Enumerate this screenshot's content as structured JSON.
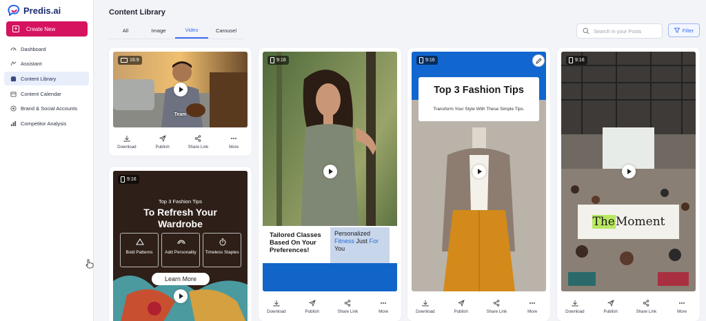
{
  "app": {
    "name": "Predis.ai"
  },
  "sidebar": {
    "create_label": "Create New",
    "items": [
      {
        "label": "Dashboard",
        "icon": "dashboard-icon"
      },
      {
        "label": "Assistant",
        "icon": "assistant-icon"
      },
      {
        "label": "Content Library",
        "icon": "library-icon",
        "active": true
      },
      {
        "label": "Content Calendar",
        "icon": "calendar-icon"
      },
      {
        "label": "Brand & Social Accounts",
        "icon": "brand-icon"
      },
      {
        "label": "Competitor Analysis",
        "icon": "analysis-icon"
      }
    ]
  },
  "header": {
    "title": "Content Library",
    "tabs": [
      {
        "label": "All"
      },
      {
        "label": "Image"
      },
      {
        "label": "Video",
        "active": true
      },
      {
        "label": "Carousel"
      }
    ],
    "search_placeholder": "Search in your Posts",
    "filter_label": "Filter"
  },
  "actions": {
    "download": "Download",
    "publish": "Publish",
    "share": "Share Link",
    "more": "More"
  },
  "cards": {
    "c1": {
      "ratio": "16:9",
      "caption": "Team"
    },
    "c2": {
      "ratio": "9:16",
      "kicker": "Top 3 Fashion Tips",
      "headline": "To Refresh Your Wardrobe",
      "tips": [
        "Bold Patterns",
        "Add Personality",
        "Timeless Staples"
      ],
      "cta": "Learn More"
    },
    "c3": {
      "ratio": "9:16",
      "left_text": "Tailored Classes Based On Your Preferences!",
      "right_pre": "Personalized ",
      "right_hl1": "Fitness",
      "right_mid": " Just ",
      "right_hl2": "For",
      "right_post": " You"
    },
    "c4": {
      "ratio": "9:16",
      "title": "Top 3 Fashion Tips",
      "subtitle": "Transform Your Style With These Simple Tips."
    },
    "c5": {
      "ratio": "9:16",
      "overlay_pre": "The",
      "overlay_post": " Moment"
    }
  },
  "colors": {
    "accent": "#3a6df0",
    "brand": "#d6135f",
    "navy": "#1a2b6d"
  }
}
